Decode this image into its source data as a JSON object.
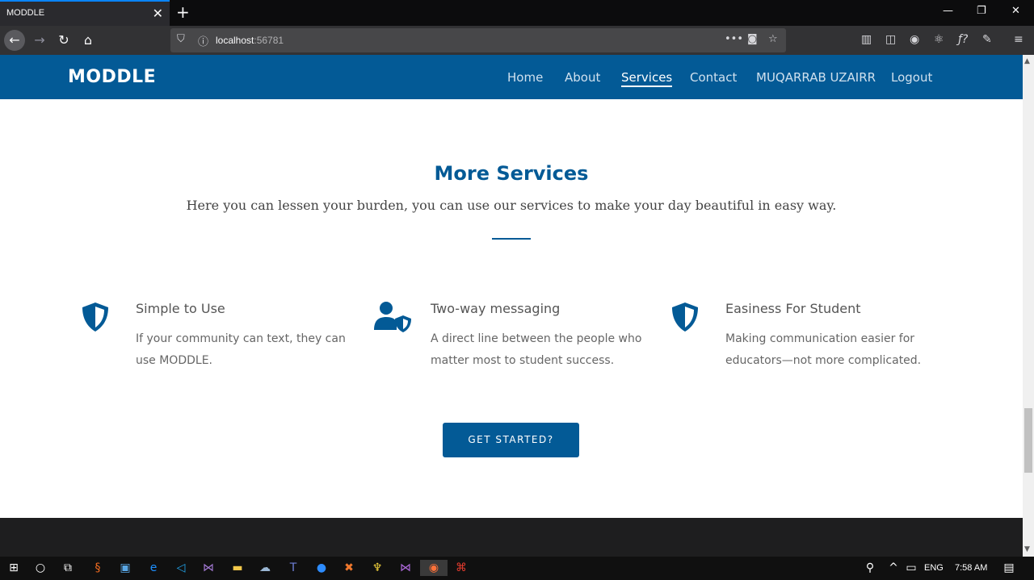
{
  "browser": {
    "tab_title": "MODDLE",
    "tab_close": "✕",
    "new_tab": "+",
    "url_host": "localhost",
    "url_port": ":56781",
    "window_min": "—",
    "window_restore": "❐",
    "window_close": "✕"
  },
  "site": {
    "brand": "MODDLE",
    "nav": [
      "Home",
      "About",
      "Services",
      "Contact",
      "MUQARRAB UZAIRR",
      "Logout"
    ],
    "active_nav": "Services"
  },
  "section": {
    "title": "More Services",
    "subtitle": "Here you can lessen your burden, you can use our services to make your day beautiful in easy way."
  },
  "services": [
    {
      "title": "Simple to Use",
      "description": "If your community can text, they can use MODDLE.",
      "icon": "shield-icon"
    },
    {
      "title": "Two-way messaging",
      "description": "A direct line between the people who matter most to student success.",
      "icon": "user-shield-icon"
    },
    {
      "title": "Easiness For Student",
      "description": "Making communication easier for educators—not more complicated.",
      "icon": "shield-icon"
    }
  ],
  "cta_label": "GET STARTED?",
  "taskbar": {
    "lang": "ENG",
    "time": "7:58 AM"
  },
  "colors": {
    "brand_blue": "#035a96",
    "footer": "#1e1e1f"
  }
}
